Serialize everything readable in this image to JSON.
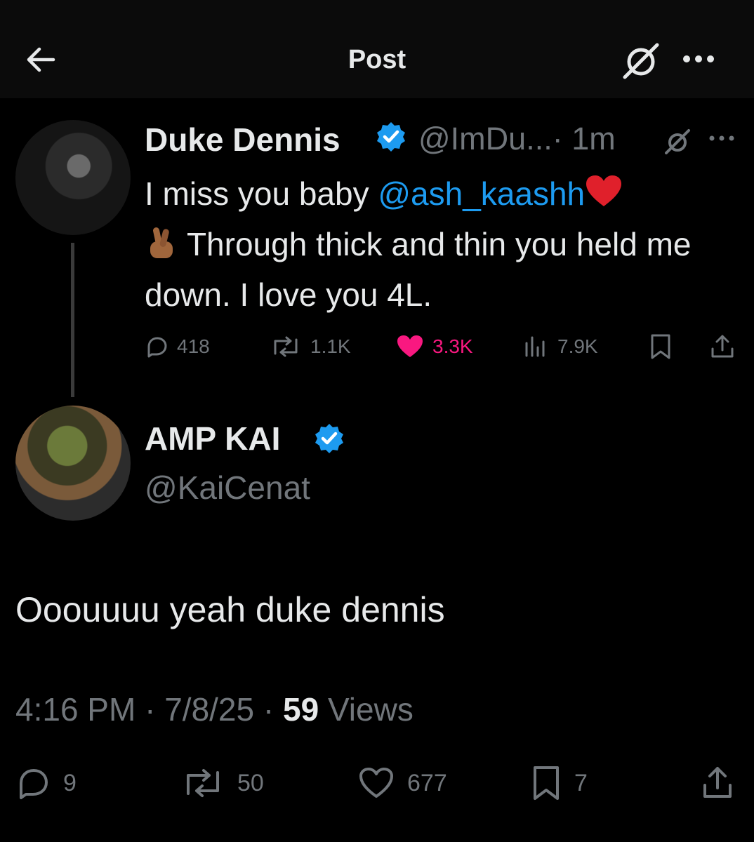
{
  "header": {
    "title": "Post"
  },
  "parent_post": {
    "author_name": "Duke Dennis",
    "handle_time": "@ImDu...· 1m",
    "text_part1": "I miss you baby ",
    "mention": "@ash_kaashh",
    "text_part2": " Through thick and thin you held me down. I love you 4L.",
    "stats": {
      "replies": "418",
      "reposts": "1.1K",
      "likes": "3.3K",
      "views": "7.9K"
    }
  },
  "main_post": {
    "author_name": "AMP KAI",
    "handle": "@KaiCenat",
    "text": "Ooouuuu yeah duke dennis",
    "time": "4:16 PM",
    "date": "7/8/25",
    "views_count": "59",
    "views_label": "Views",
    "stats": {
      "replies": "9",
      "reposts": "50",
      "likes": "677",
      "bookmarks": "7"
    }
  },
  "colors": {
    "background": "#000000",
    "text": "#e7e9ea",
    "muted": "#71767b",
    "link": "#1d9bf0",
    "like": "#f91880",
    "verified": "#1d9bf0"
  },
  "icons": [
    "back-arrow-icon",
    "grok-icon",
    "more-icon",
    "verified-badge-icon",
    "heart-emoji-icon",
    "crossed-fingers-emoji-icon",
    "reply-icon",
    "repost-icon",
    "like-icon",
    "views-icon",
    "bookmark-icon",
    "share-icon"
  ]
}
